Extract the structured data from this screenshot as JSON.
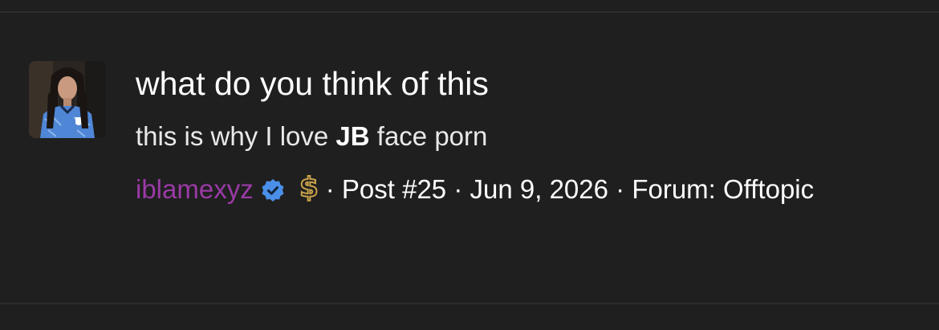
{
  "post": {
    "title": "what do you think of this",
    "snippet": {
      "before": "this is why I love ",
      "highlight": "JB",
      "after": " face porn"
    },
    "author": "iblamexyz",
    "post_number": "Post #25",
    "date": "Jun 9, 2026",
    "forum_label": "Forum:",
    "forum": "Offtopic",
    "separator": "·",
    "author_color": "#9a3aa6",
    "verified_badge_color": "#4a8fe8",
    "dollar_badge_color": "#c9a24a"
  },
  "icons": {
    "avatar": "avatar-photo",
    "verified": "verified-check-icon",
    "dollar": "dollar-badge-icon"
  }
}
